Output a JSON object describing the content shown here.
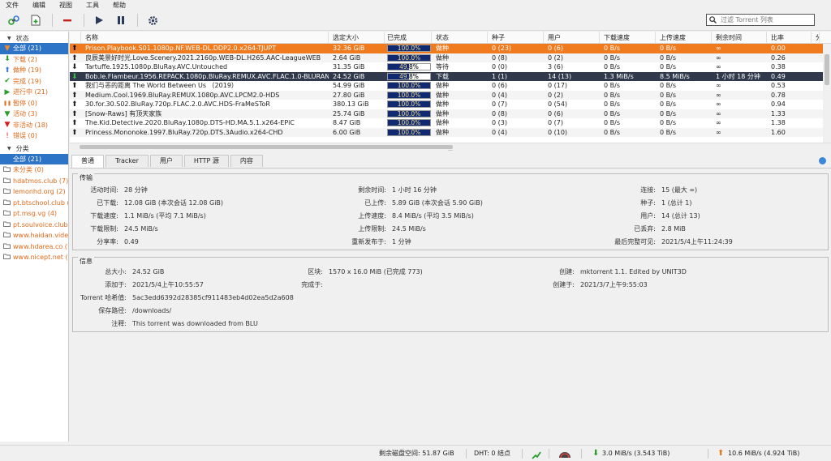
{
  "menu": [
    "文件",
    "编辑",
    "视图",
    "工具",
    "帮助"
  ],
  "filter": {
    "placeholder": "过滤 Torrent 列表"
  },
  "sidebar": {
    "status_header": "状态",
    "status_items": [
      {
        "label": "全部 (21)",
        "icon": "filter-icon",
        "color": "#e06a1a",
        "selected": true
      },
      {
        "label": "下载 (2)",
        "icon": "download-arrow-icon",
        "color": "#2a9d2a"
      },
      {
        "label": "做种 (19)",
        "icon": "upload-arrow-icon",
        "color": "#3b7bd6"
      },
      {
        "label": "完成 (19)",
        "icon": "check-icon",
        "color": "#2a9d2a"
      },
      {
        "label": "进行中 (21)",
        "icon": "play-icon",
        "color": "#2a9d2a"
      },
      {
        "label": "暂停 (0)",
        "icon": "pause-icon",
        "color": "#e06a1a"
      },
      {
        "label": "活动 (3)",
        "icon": "filter-icon",
        "color": "#2a9d2a"
      },
      {
        "label": "非活动 (18)",
        "icon": "filter-icon",
        "color": "#d62020"
      },
      {
        "label": "错误 (0)",
        "icon": "error-icon",
        "color": "#d62020"
      }
    ],
    "category_header": "分类",
    "category_items": [
      {
        "label": "全部 (21)",
        "selected": true
      },
      {
        "label": "未分类 (0)"
      }
    ],
    "tracker_items": [
      {
        "label": "hdatmos.club (7)"
      },
      {
        "label": "lemonhd.org (2)"
      },
      {
        "label": "pt.btschool.club (1)"
      },
      {
        "label": "pt.msg.vg (4)"
      },
      {
        "label": "pt.soulvoice.club (1)"
      },
      {
        "label": "www.haidan.video (1)"
      },
      {
        "label": "www.hdarea.co (1)"
      },
      {
        "label": "www.nicept.net (2)"
      }
    ]
  },
  "table": {
    "columns": [
      "名称",
      "选定大小",
      "已完成",
      "状态",
      "种子",
      "用户",
      "下载速度",
      "上传速度",
      "剩余时间",
      "比率",
      "分"
    ],
    "rows": [
      {
        "name": "Prison.Playbook.S01.1080p.NF.WEB-DL.DDP2.0.x264-TJUPT",
        "size": "32.36 GiB",
        "progress": 1.0,
        "progress_text": "100.0%",
        "status": "做种",
        "seeds": "0 (23)",
        "peers": "0 (6)",
        "dl": "0 B/s",
        "ul": "0 B/s",
        "eta": "∞",
        "ratio": "0.00",
        "icon": "up",
        "style": "sel-orange"
      },
      {
        "name": "良辰美景好时光.Love.Scenery.2021.2160p.WEB-DL.H265.AAC-LeagueWEB",
        "size": "2.64 GiB",
        "progress": 1.0,
        "progress_text": "100.0%",
        "status": "做种",
        "seeds": "0 (8)",
        "peers": "0 (2)",
        "dl": "0 B/s",
        "ul": "0 B/s",
        "eta": "∞",
        "ratio": "0.26",
        "icon": "up",
        "style": "alt"
      },
      {
        "name": "Tartuffe.1925.1080p.BluRay.AVC.Untouched",
        "size": "31.35 GiB",
        "progress": 0.498,
        "progress_text": "49.8%",
        "status": "等待",
        "seeds": "0 (0)",
        "peers": "3 (6)",
        "dl": "0 B/s",
        "ul": "0 B/s",
        "eta": "∞",
        "ratio": "0.38",
        "icon": "down",
        "style": ""
      },
      {
        "name": "Bob.le.Flambeur.1956.REPACK.1080p.BluRay.REMUX.AVC.FLAC.1.0-BLURANIUM",
        "size": "24.52 GiB",
        "progress": 0.498,
        "progress_text": "49.8%",
        "status": "下载",
        "seeds": "1 (1)",
        "peers": "14 (13)",
        "dl": "1.3 MiB/s",
        "ul": "8.5 MiB/s",
        "eta": "1 小时 18 分钟",
        "ratio": "0.49",
        "icon": "down-green",
        "style": "sel-dark"
      },
      {
        "name": "我们与恶的距离 The World Between Us （2019）",
        "size": "54.99 GiB",
        "progress": 1.0,
        "progress_text": "100.0%",
        "status": "做种",
        "seeds": "0 (6)",
        "peers": "0 (17)",
        "dl": "0 B/s",
        "ul": "0 B/s",
        "eta": "∞",
        "ratio": "0.53",
        "icon": "up",
        "style": ""
      },
      {
        "name": "Medium.Cool.1969.BluRay.REMUX.1080p.AVC.LPCM2.0-HDS",
        "size": "27.80 GiB",
        "progress": 1.0,
        "progress_text": "100.0%",
        "status": "做种",
        "seeds": "0 (4)",
        "peers": "0 (2)",
        "dl": "0 B/s",
        "ul": "0 B/s",
        "eta": "∞",
        "ratio": "0.78",
        "icon": "up",
        "style": "alt"
      },
      {
        "name": "30.for.30.S02.BluRay.720p.FLAC.2.0.AVC.HDS-FraMeSToR",
        "size": "380.13 GiB",
        "progress": 1.0,
        "progress_text": "100.0%",
        "status": "做种",
        "seeds": "0 (7)",
        "peers": "0 (54)",
        "dl": "0 B/s",
        "ul": "0 B/s",
        "eta": "∞",
        "ratio": "0.94",
        "icon": "up",
        "style": ""
      },
      {
        "name": "[Snow-Raws] 有顶天家族",
        "size": "25.74 GiB",
        "progress": 1.0,
        "progress_text": "100.0%",
        "status": "做种",
        "seeds": "0 (8)",
        "peers": "0 (6)",
        "dl": "0 B/s",
        "ul": "0 B/s",
        "eta": "∞",
        "ratio": "1.33",
        "icon": "up",
        "style": "alt"
      },
      {
        "name": "The.Kid.Detective.2020.BluRay.1080p.DTS-HD.MA.5.1.x264-EPiC",
        "size": "8.47 GiB",
        "progress": 1.0,
        "progress_text": "100.0%",
        "status": "做种",
        "seeds": "0 (3)",
        "peers": "0 (7)",
        "dl": "0 B/s",
        "ul": "0 B/s",
        "eta": "∞",
        "ratio": "1.38",
        "icon": "up",
        "style": ""
      },
      {
        "name": "Princess.Mononoke.1997.BluRay.720p.DTS.3Audio.x264-CHD",
        "size": "6.00 GiB",
        "progress": 1.0,
        "progress_text": "100.0%",
        "status": "做种",
        "seeds": "0 (4)",
        "peers": "0 (10)",
        "dl": "0 B/s",
        "ul": "0 B/s",
        "eta": "∞",
        "ratio": "1.60",
        "icon": "up",
        "style": "alt"
      }
    ]
  },
  "tabs": [
    "普通",
    "Tracker",
    "用户",
    "HTTP 源",
    "内容"
  ],
  "transfer": {
    "title": "传输",
    "active_time_k": "活动时间:",
    "active_time_v": "28 分钟",
    "downloaded_k": "已下载:",
    "downloaded_v": "12.08 GiB (本次会话 12.08 GiB)",
    "dl_speed_k": "下载速度:",
    "dl_speed_v": "1.1 MiB/s (平均 7.1 MiB/s)",
    "dl_limit_k": "下载限制:",
    "dl_limit_v": "24.5 MiB/s",
    "share_ratio_k": "分享率:",
    "share_ratio_v": "0.49",
    "eta_k": "剩余时间:",
    "eta_v": "1 小时 16 分钟",
    "uploaded_k": "已上传:",
    "uploaded_v": "5.89 GiB (本次会话 5.90 GiB)",
    "ul_speed_k": "上传速度:",
    "ul_speed_v": "8.4 MiB/s (平均 3.5 MiB/s)",
    "ul_limit_k": "上传限制:",
    "ul_limit_v": "24.5 MiB/s",
    "reannounce_k": "重新发布于:",
    "reannounce_v": "1 分钟",
    "connections_k": "连接:",
    "connections_v": "15 (最大 ∞)",
    "seeds_k": "种子:",
    "seeds_v": "1 (总计 1)",
    "peers_k": "用户:",
    "peers_v": "14 (总计 13)",
    "wasted_k": "已丢弃:",
    "wasted_v": "2.8 MiB",
    "last_seen_k": "最后完整可见:",
    "last_seen_v": "2021/5/4上午11:24:39"
  },
  "info": {
    "title": "信息",
    "total_size_k": "总大小:",
    "total_size_v": "24.52 GiB",
    "added_on_k": "添加于:",
    "added_on_v": "2021/5/4上午10:55:57",
    "hash_k": "Torrent 哈希值:",
    "hash_v": "5ac3edd6392d28385cf911483eb4d02ea5d2a608",
    "save_path_k": "保存路径:",
    "save_path_v": "/downloads/",
    "comment_k": "注释:",
    "comment_v": "This torrent was downloaded from BLU",
    "pieces_k": "区块:",
    "pieces_v": "1570 x 16.0 MiB (已完成 773)",
    "completed_on_k": "完成于:",
    "completed_on_v": "",
    "created_by_k": "创建:",
    "created_by_v": "mktorrent 1.1. Edited by UNIT3D",
    "created_on_k": "创建于:",
    "created_on_v": "2021/3/7上午9:55:03"
  },
  "statusbar": {
    "free_space": "剩余磁盘空间: 51.87 GiB",
    "dht": "DHT: 0 结点",
    "dl": "3.0 MiB/s (3.543 TiB)",
    "ul": "10.6 MiB/s (4.924 TiB)"
  },
  "colors": {
    "selected_blue": "#2e74c6",
    "row_orange": "#f07a1e",
    "row_dark": "#303a4c",
    "progress_fill": "#102a72"
  }
}
